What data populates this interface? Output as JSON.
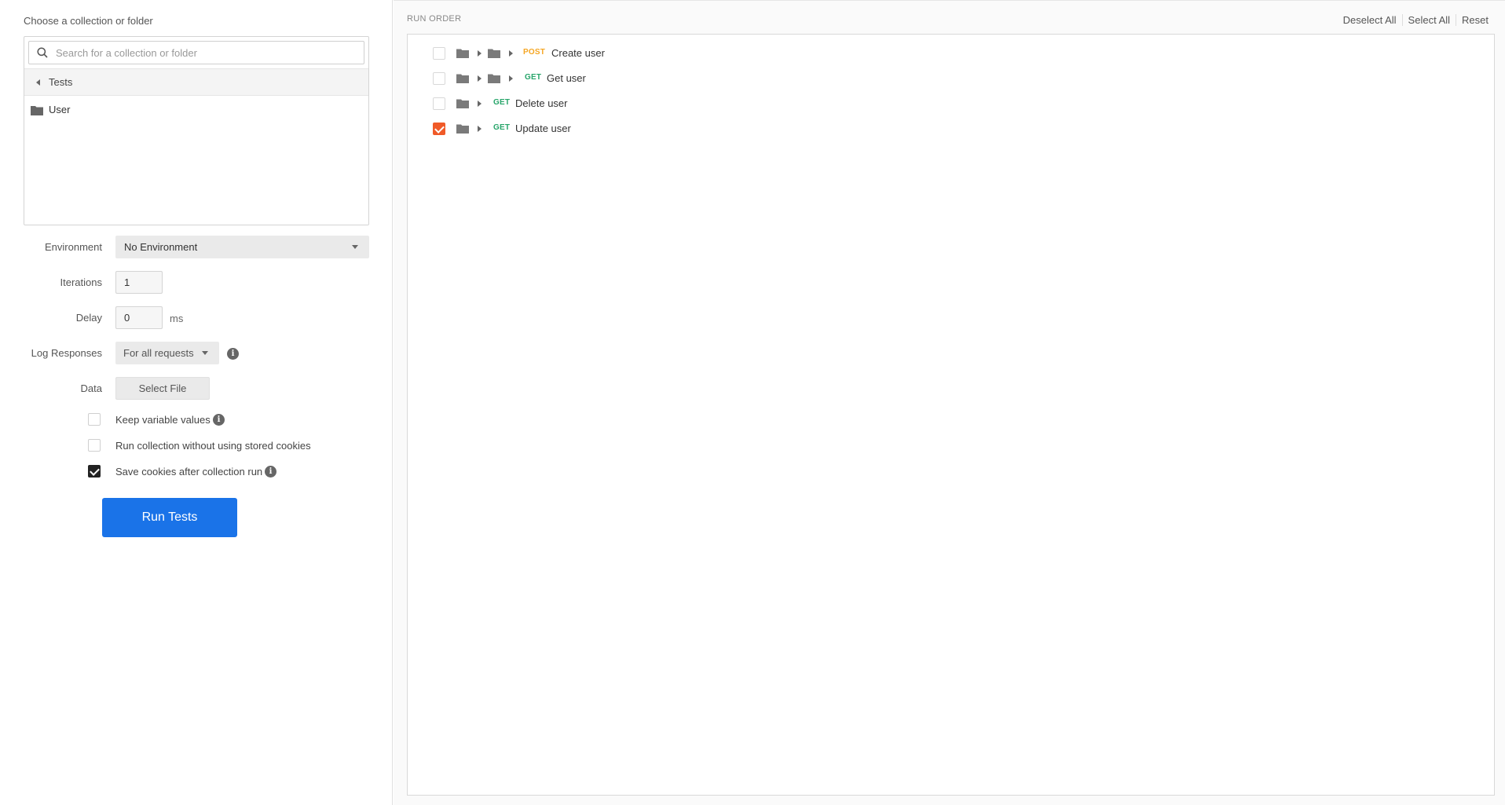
{
  "left": {
    "choose_label": "Choose a collection or folder",
    "search_placeholder": "Search for a collection or folder",
    "breadcrumb": "Tests",
    "folder_item": "User",
    "environment_label": "Environment",
    "environment_value": "No Environment",
    "iterations_label": "Iterations",
    "iterations_value": "1",
    "delay_label": "Delay",
    "delay_value": "0",
    "delay_unit": "ms",
    "log_label": "Log Responses",
    "log_value": "For all requests",
    "data_label": "Data",
    "select_file": "Select File",
    "options": [
      {
        "label": "Keep variable values",
        "checked": false
      },
      {
        "label": "Run collection without using stored cookies",
        "checked": false
      },
      {
        "label": "Save cookies after collection run",
        "checked": true
      }
    ],
    "run_button": "Run Tests"
  },
  "right": {
    "title": "RUN ORDER",
    "actions": [
      "Deselect All",
      "Select All",
      "Reset"
    ],
    "requests": [
      {
        "method": "POST",
        "name": "Create user",
        "checked": false
      },
      {
        "method": "GET",
        "name": "Get user",
        "checked": false
      },
      {
        "method": "GET",
        "name": "Delete user",
        "checked": false
      },
      {
        "method": "GET",
        "name": "Update user",
        "checked": true
      }
    ]
  },
  "colors": {
    "primary": "#1a73e8",
    "accent": "#f05a28",
    "post": "#f5a623",
    "get": "#27a56a"
  }
}
